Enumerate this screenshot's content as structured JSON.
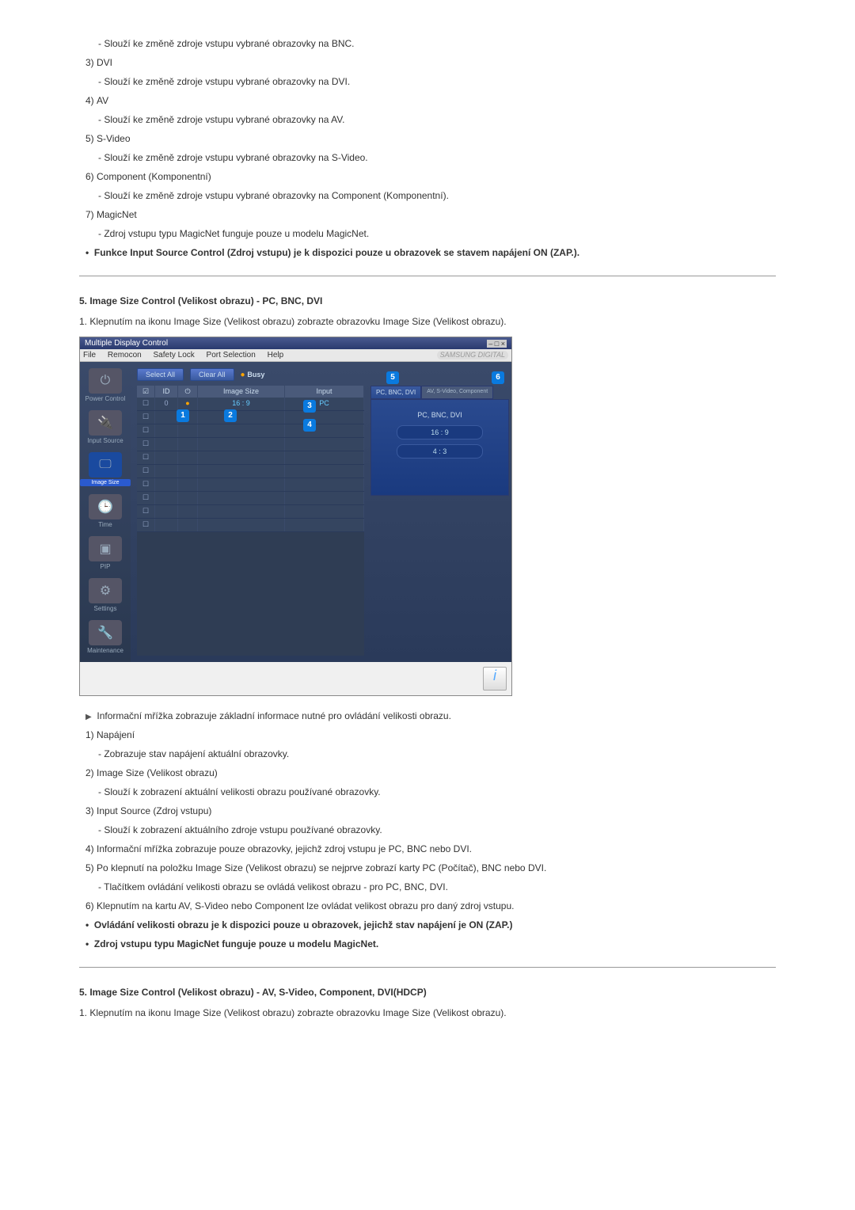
{
  "items_top": [
    {
      "text": "- Slouží ke změně zdroje vstupu vybrané obrazovky na BNC."
    },
    {
      "num": "3)",
      "label": "DVI"
    },
    {
      "text": "- Slouží ke změně zdroje vstupu vybrané obrazovky na DVI."
    },
    {
      "num": "4)",
      "label": "AV"
    },
    {
      "text": "- Slouží ke změně zdroje vstupu vybrané obrazovky na AV."
    },
    {
      "num": "5)",
      "label": "S-Video"
    },
    {
      "text": "- Slouží ke změně zdroje vstupu vybrané obrazovky na S-Video."
    },
    {
      "num": "6)",
      "label": "Component (Komponentní)"
    },
    {
      "text": "- Slouží ke změně zdroje vstupu vybrané obrazovky na Component (Komponentní)."
    },
    {
      "num": "7)",
      "label": "MagicNet"
    },
    {
      "text": "- Zdroj vstupu typu MagicNet funguje pouze u modelu MagicNet."
    }
  ],
  "bullet_top": "Funkce Input Source Control (Zdroj vstupu) je k dispozici pouze u obrazovek se stavem napájení ON (ZAP.).",
  "section5a_title": "5. Image Size Control (Velikost obrazu) - PC, BNC, DVI",
  "section5a_step": "1.  Klepnutím na ikonu Image Size (Velikost obrazu) zobrazte obrazovku Image Size (Velikost obrazu).",
  "app": {
    "title": "Multiple Display Control",
    "win_icons": "–  □  ×",
    "menu": [
      "File",
      "Remocon",
      "Safety Lock",
      "Port Selection",
      "Help"
    ],
    "brand": "SAMSUNG DIGITAL",
    "select_all": "Select All",
    "clear_all": "Clear All",
    "busy": "Busy",
    "cols": {
      "id": "ID",
      "size": "Image Size",
      "input": "Input"
    },
    "row0": {
      "id": "0",
      "size": "16 : 9",
      "input": "PC"
    },
    "tab_active": "PC, BNC, DVI",
    "tab_inactive": "AV, S-Video, Component",
    "ctrl_title": "PC, BNC, DVI",
    "pill1": "16 : 9",
    "pill2": "4 : 3",
    "side": [
      "Power Control",
      "Input Source",
      "Image Size",
      "Time",
      "PIP",
      "Settings",
      "Maintenance"
    ],
    "callouts": {
      "c1": "1",
      "c2": "2",
      "c3": "3",
      "c4": "4",
      "c5": "5",
      "c6": "6"
    }
  },
  "info_line": "Informační mřížka zobrazuje základní informace nutné pro ovládání velikosti obrazu.",
  "items_bottom": [
    {
      "num": "1)",
      "label": "Napájení"
    },
    {
      "text": "- Zobrazuje stav napájení aktuální obrazovky."
    },
    {
      "num": "2)",
      "label": "Image Size (Velikost obrazu)"
    },
    {
      "text": "- Slouží k zobrazení aktuální velikosti obrazu používané obrazovky."
    },
    {
      "num": "3)",
      "label": "Input Source (Zdroj vstupu)"
    },
    {
      "text": "- Slouží k zobrazení aktuálního zdroje vstupu používané obrazovky."
    },
    {
      "num": "4)",
      "label": "Informační mřížka zobrazuje pouze obrazovky, jejichž zdroj vstupu je PC, BNC nebo DVI."
    },
    {
      "num": "5)",
      "label": "Po klepnutí na položku Image Size (Velikost obrazu) se nejprve zobrazí karty PC (Počítač), BNC nebo DVI."
    },
    {
      "text": "- Tlačítkem ovládání velikosti obrazu se ovládá velikost obrazu - pro PC, BNC, DVI."
    },
    {
      "num": "6)",
      "label": "Klepnutím na kartu AV, S-Video nebo Component lze ovládat velikost obrazu pro daný zdroj vstupu."
    }
  ],
  "bullets_bottom": [
    "Ovládání velikosti obrazu je k dispozici pouze u obrazovek, jejichž stav napájení je ON (ZAP.)",
    "Zdroj vstupu typu MagicNet funguje pouze u modelu MagicNet."
  ],
  "section5b_title": "5. Image Size Control (Velikost obrazu) - AV, S-Video, Component, DVI(HDCP)",
  "section5b_step": "1.  Klepnutím na ikonu Image Size (Velikost obrazu) zobrazte obrazovku Image Size (Velikost obrazu)."
}
